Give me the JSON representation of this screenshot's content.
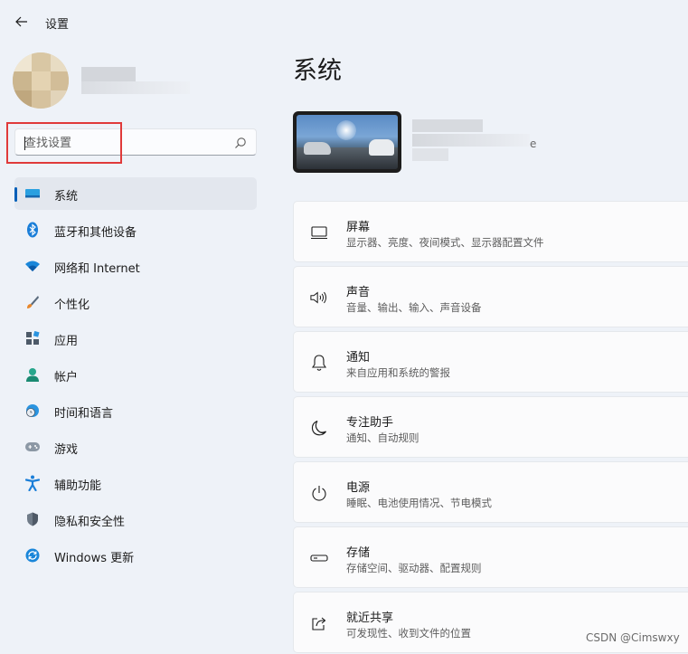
{
  "window": {
    "title": "设置",
    "back_icon": "arrow-left-icon"
  },
  "search": {
    "placeholder": "查找设置"
  },
  "sidebar": {
    "items": [
      {
        "label": "系统",
        "icon": "display-system-icon",
        "active": true
      },
      {
        "label": "蓝牙和其他设备",
        "icon": "bluetooth-icon"
      },
      {
        "label": "网络和 Internet",
        "icon": "wifi-icon"
      },
      {
        "label": "个性化",
        "icon": "paintbrush-icon"
      },
      {
        "label": "应用",
        "icon": "apps-icon"
      },
      {
        "label": "帐户",
        "icon": "account-icon"
      },
      {
        "label": "时间和语言",
        "icon": "globe-clock-icon"
      },
      {
        "label": "游戏",
        "icon": "gamepad-icon"
      },
      {
        "label": "辅助功能",
        "icon": "accessibility-icon"
      },
      {
        "label": "隐私和安全性",
        "icon": "shield-icon"
      },
      {
        "label": "Windows 更新",
        "icon": "windows-update-icon"
      }
    ]
  },
  "main": {
    "title": "系统",
    "device_tail": "e",
    "cards": [
      {
        "title": "屏幕",
        "subtitle": "显示器、亮度、夜间模式、显示器配置文件",
        "icon": "monitor-icon"
      },
      {
        "title": "声音",
        "subtitle": "音量、输出、输入、声音设备",
        "icon": "speaker-icon"
      },
      {
        "title": "通知",
        "subtitle": "来自应用和系统的警报",
        "icon": "bell-icon"
      },
      {
        "title": "专注助手",
        "subtitle": "通知、自动规则",
        "icon": "moon-icon"
      },
      {
        "title": "电源",
        "subtitle": "睡眠、电池使用情况、节电模式",
        "icon": "power-icon"
      },
      {
        "title": "存储",
        "subtitle": "存储空间、驱动器、配置规则",
        "icon": "storage-drive-icon"
      },
      {
        "title": "就近共享",
        "subtitle": "可发现性、收到文件的位置",
        "icon": "share-icon"
      }
    ]
  },
  "watermark": "CSDN @Cimswxy",
  "colors": {
    "accent": "#005fb8",
    "highlight_box": "#e03a3a",
    "background": "#eef2f8"
  }
}
